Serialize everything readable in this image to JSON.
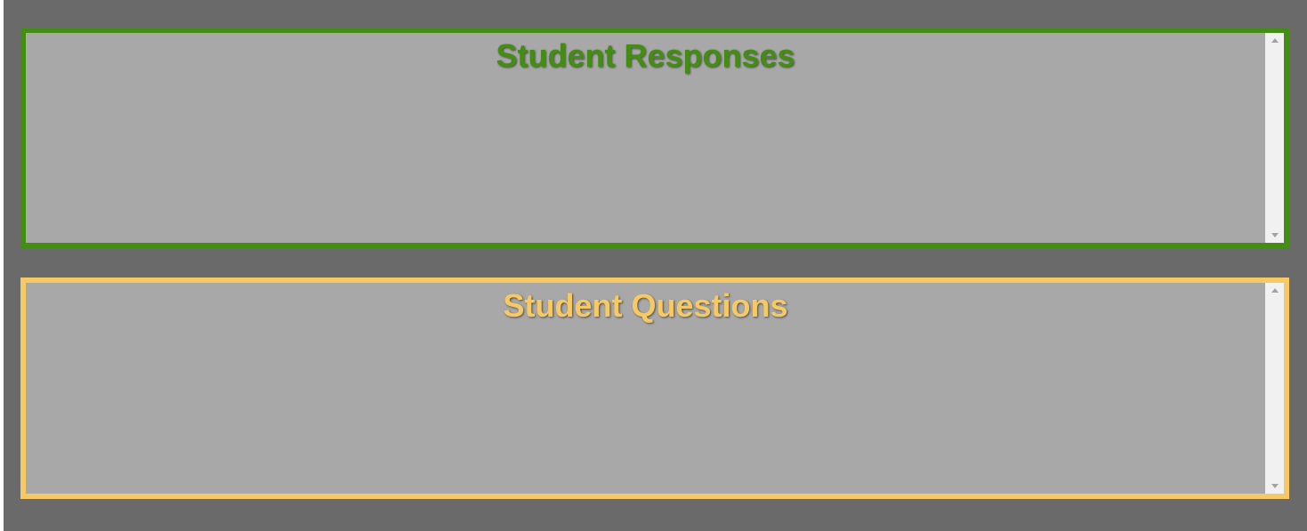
{
  "colors": {
    "page_background": "#6a6a6a",
    "panel_background": "#a8a8a8",
    "responses_accent": "#438d12",
    "questions_accent": "#f6c965",
    "scrollbar_track": "#f1f1f1",
    "scrollbar_arrow": "#a3a3a3"
  },
  "panels": {
    "responses": {
      "title": "Student Responses"
    },
    "questions": {
      "title": "Student Questions"
    }
  },
  "icons": {
    "scroll_up": "scroll-up-arrow-icon",
    "scroll_down": "scroll-down-arrow-icon"
  }
}
